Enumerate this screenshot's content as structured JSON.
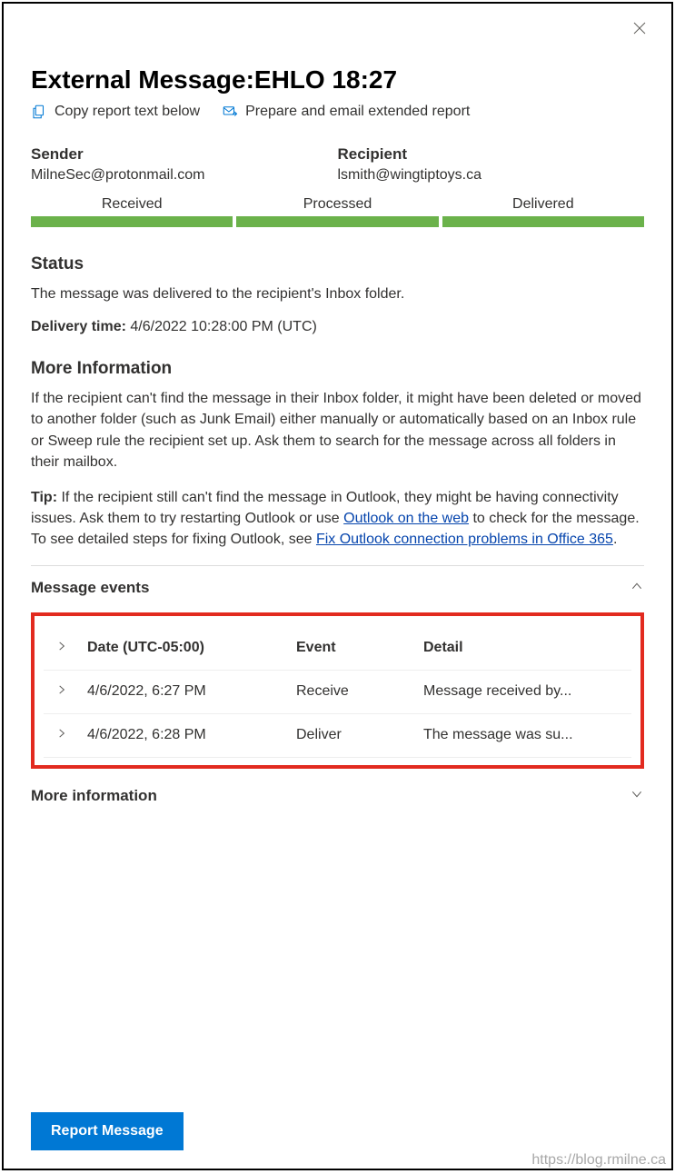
{
  "title": "External Message:EHLO 18:27",
  "actions": {
    "copy_label": "Copy report text below",
    "prepare_label": "Prepare and email extended report"
  },
  "sender": {
    "label": "Sender",
    "value": "MilneSec@protonmail.com"
  },
  "recipient": {
    "label": "Recipient",
    "value": "lsmith@wingtiptoys.ca"
  },
  "progress": {
    "received": "Received",
    "processed": "Processed",
    "delivered": "Delivered"
  },
  "status": {
    "heading": "Status",
    "text": "The message was delivered to the recipient's Inbox folder."
  },
  "delivery": {
    "label": "Delivery time:",
    "value": "4/6/2022 10:28:00 PM (UTC)"
  },
  "more_info": {
    "heading": "More Information",
    "body": "If the recipient can't find the message in their Inbox folder, it might have been deleted or moved to another folder (such as Junk Email) either manually or automatically based on an Inbox rule or Sweep rule the recipient set up. Ask them to search for the message across all folders in their mailbox.",
    "tip_label": "Tip:",
    "tip_pre": " If the recipient still can't find the message in Outlook, they might be having connectivity issues. Ask them to try restarting Outlook or use ",
    "link1": "Outlook on the web",
    "tip_mid": " to check for the message. To see detailed steps for fixing Outlook, see ",
    "link2": "Fix Outlook connection problems in Office 365",
    "tip_end": "."
  },
  "events": {
    "heading": "Message events",
    "columns": {
      "date": "Date (UTC-05:00)",
      "event": "Event",
      "detail": "Detail"
    },
    "rows": [
      {
        "date": "4/6/2022, 6:27 PM",
        "event": "Receive",
        "detail": "Message received by..."
      },
      {
        "date": "4/6/2022, 6:28 PM",
        "event": "Deliver",
        "detail": "The message was su..."
      }
    ]
  },
  "more_information_section": "More information",
  "footer": {
    "report_button": "Report Message"
  },
  "watermark": "https://blog.rmilne.ca"
}
